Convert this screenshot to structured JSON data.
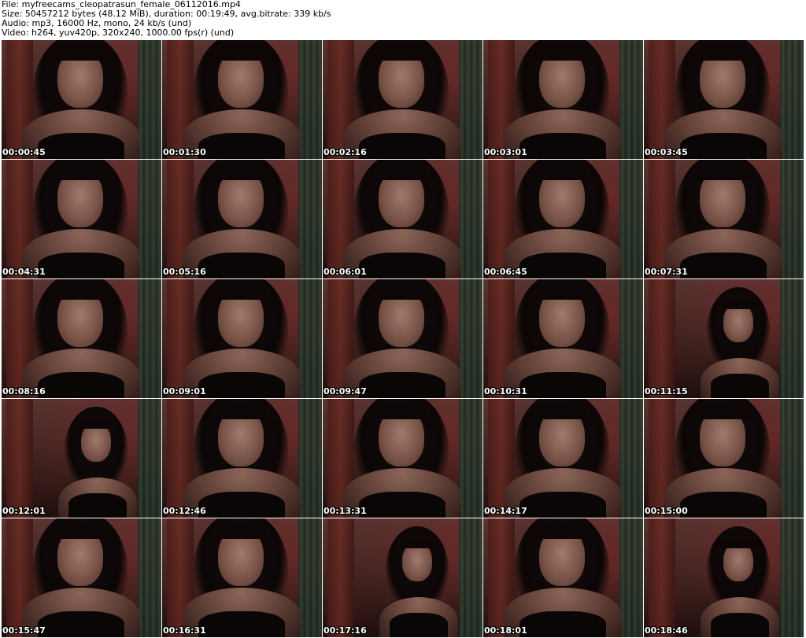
{
  "header": {
    "file": "File: myfreecams_cleopatrasun_female_06112016.mp4",
    "size": "Size: 50457212 bytes (48.12 MiB), duration: 00:19:49, avg.bitrate: 339 kb/s",
    "audio": "Audio: mp3, 16000 Hz, mono, 24 kb/s (und)",
    "video": "Video: h264, yuv420p, 320x240, 1000.00 fps(r) (und)"
  },
  "thumbnails": [
    {
      "timestamp": "00:00:45"
    },
    {
      "timestamp": "00:01:30"
    },
    {
      "timestamp": "00:02:16"
    },
    {
      "timestamp": "00:03:01"
    },
    {
      "timestamp": "00:03:45"
    },
    {
      "timestamp": "00:04:31"
    },
    {
      "timestamp": "00:05:16"
    },
    {
      "timestamp": "00:06:01"
    },
    {
      "timestamp": "00:06:45"
    },
    {
      "timestamp": "00:07:31"
    },
    {
      "timestamp": "00:08:16"
    },
    {
      "timestamp": "00:09:01"
    },
    {
      "timestamp": "00:09:47"
    },
    {
      "timestamp": "00:10:31"
    },
    {
      "timestamp": "00:11:15"
    },
    {
      "timestamp": "00:12:01"
    },
    {
      "timestamp": "00:12:46"
    },
    {
      "timestamp": "00:13:31"
    },
    {
      "timestamp": "00:14:17"
    },
    {
      "timestamp": "00:15:00"
    },
    {
      "timestamp": "00:15:47"
    },
    {
      "timestamp": "00:16:31"
    },
    {
      "timestamp": "00:17:16"
    },
    {
      "timestamp": "00:18:01"
    },
    {
      "timestamp": "00:18:46"
    }
  ]
}
